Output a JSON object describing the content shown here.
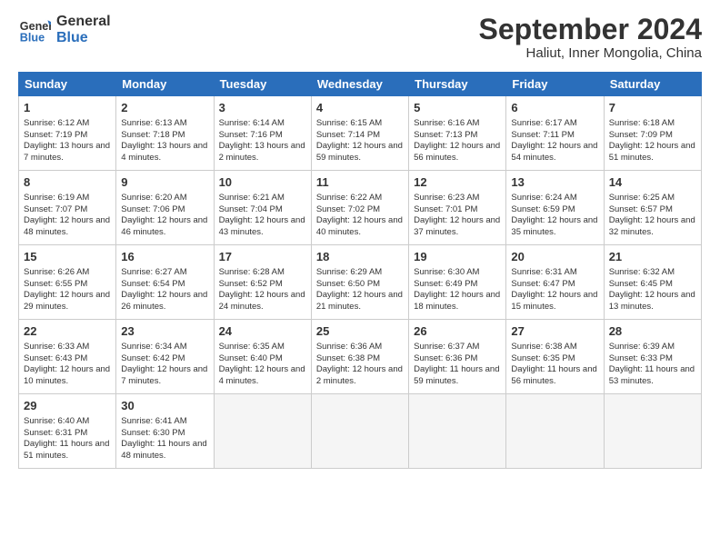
{
  "header": {
    "logo_line1": "General",
    "logo_line2": "Blue",
    "month": "September 2024",
    "location": "Haliut, Inner Mongolia, China"
  },
  "days": [
    "Sunday",
    "Monday",
    "Tuesday",
    "Wednesday",
    "Thursday",
    "Friday",
    "Saturday"
  ],
  "cells": [
    {
      "day": "",
      "empty": true
    },
    {
      "day": "",
      "empty": true
    },
    {
      "day": "",
      "empty": true
    },
    {
      "day": "",
      "empty": true
    },
    {
      "day": "",
      "empty": true
    },
    {
      "day": "",
      "empty": true
    },
    {
      "day": "7",
      "sunrise": "Sunrise: 6:18 AM",
      "sunset": "Sunset: 7:09 PM",
      "daylight": "Daylight: 12 hours and 51 minutes."
    },
    {
      "day": "8",
      "sunrise": "Sunrise: 6:19 AM",
      "sunset": "Sunset: 7:07 PM",
      "daylight": "Daylight: 12 hours and 48 minutes."
    },
    {
      "day": "9",
      "sunrise": "Sunrise: 6:20 AM",
      "sunset": "Sunset: 7:06 PM",
      "daylight": "Daylight: 12 hours and 46 minutes."
    },
    {
      "day": "10",
      "sunrise": "Sunrise: 6:21 AM",
      "sunset": "Sunset: 7:04 PM",
      "daylight": "Daylight: 12 hours and 43 minutes."
    },
    {
      "day": "11",
      "sunrise": "Sunrise: 6:22 AM",
      "sunset": "Sunset: 7:02 PM",
      "daylight": "Daylight: 12 hours and 40 minutes."
    },
    {
      "day": "12",
      "sunrise": "Sunrise: 6:23 AM",
      "sunset": "Sunset: 7:01 PM",
      "daylight": "Daylight: 12 hours and 37 minutes."
    },
    {
      "day": "13",
      "sunrise": "Sunrise: 6:24 AM",
      "sunset": "Sunset: 6:59 PM",
      "daylight": "Daylight: 12 hours and 35 minutes."
    },
    {
      "day": "14",
      "sunrise": "Sunrise: 6:25 AM",
      "sunset": "Sunset: 6:57 PM",
      "daylight": "Daylight: 12 hours and 32 minutes."
    },
    {
      "day": "15",
      "sunrise": "Sunrise: 6:26 AM",
      "sunset": "Sunset: 6:55 PM",
      "daylight": "Daylight: 12 hours and 29 minutes."
    },
    {
      "day": "16",
      "sunrise": "Sunrise: 6:27 AM",
      "sunset": "Sunset: 6:54 PM",
      "daylight": "Daylight: 12 hours and 26 minutes."
    },
    {
      "day": "17",
      "sunrise": "Sunrise: 6:28 AM",
      "sunset": "Sunset: 6:52 PM",
      "daylight": "Daylight: 12 hours and 24 minutes."
    },
    {
      "day": "18",
      "sunrise": "Sunrise: 6:29 AM",
      "sunset": "Sunset: 6:50 PM",
      "daylight": "Daylight: 12 hours and 21 minutes."
    },
    {
      "day": "19",
      "sunrise": "Sunrise: 6:30 AM",
      "sunset": "Sunset: 6:49 PM",
      "daylight": "Daylight: 12 hours and 18 minutes."
    },
    {
      "day": "20",
      "sunrise": "Sunrise: 6:31 AM",
      "sunset": "Sunset: 6:47 PM",
      "daylight": "Daylight: 12 hours and 15 minutes."
    },
    {
      "day": "21",
      "sunrise": "Sunrise: 6:32 AM",
      "sunset": "Sunset: 6:45 PM",
      "daylight": "Daylight: 12 hours and 13 minutes."
    },
    {
      "day": "22",
      "sunrise": "Sunrise: 6:33 AM",
      "sunset": "Sunset: 6:43 PM",
      "daylight": "Daylight: 12 hours and 10 minutes."
    },
    {
      "day": "23",
      "sunrise": "Sunrise: 6:34 AM",
      "sunset": "Sunset: 6:42 PM",
      "daylight": "Daylight: 12 hours and 7 minutes."
    },
    {
      "day": "24",
      "sunrise": "Sunrise: 6:35 AM",
      "sunset": "Sunset: 6:40 PM",
      "daylight": "Daylight: 12 hours and 4 minutes."
    },
    {
      "day": "25",
      "sunrise": "Sunrise: 6:36 AM",
      "sunset": "Sunset: 6:38 PM",
      "daylight": "Daylight: 12 hours and 2 minutes."
    },
    {
      "day": "26",
      "sunrise": "Sunrise: 6:37 AM",
      "sunset": "Sunset: 6:36 PM",
      "daylight": "Daylight: 11 hours and 59 minutes."
    },
    {
      "day": "27",
      "sunrise": "Sunrise: 6:38 AM",
      "sunset": "Sunset: 6:35 PM",
      "daylight": "Daylight: 11 hours and 56 minutes."
    },
    {
      "day": "28",
      "sunrise": "Sunrise: 6:39 AM",
      "sunset": "Sunset: 6:33 PM",
      "daylight": "Daylight: 11 hours and 53 minutes."
    },
    {
      "day": "29",
      "sunrise": "Sunrise: 6:40 AM",
      "sunset": "Sunset: 6:31 PM",
      "daylight": "Daylight: 11 hours and 51 minutes."
    },
    {
      "day": "30",
      "sunrise": "Sunrise: 6:41 AM",
      "sunset": "Sunset: 6:30 PM",
      "daylight": "Daylight: 11 hours and 48 minutes."
    },
    {
      "day": "",
      "empty": true
    },
    {
      "day": "",
      "empty": true
    },
    {
      "day": "",
      "empty": true
    },
    {
      "day": "",
      "empty": true
    },
    {
      "day": "",
      "empty": true
    }
  ],
  "week1": [
    {
      "day": "1",
      "sunrise": "Sunrise: 6:12 AM",
      "sunset": "Sunset: 7:19 PM",
      "daylight": "Daylight: 13 hours and 7 minutes."
    },
    {
      "day": "2",
      "sunrise": "Sunrise: 6:13 AM",
      "sunset": "Sunset: 7:18 PM",
      "daylight": "Daylight: 13 hours and 4 minutes."
    },
    {
      "day": "3",
      "sunrise": "Sunrise: 6:14 AM",
      "sunset": "Sunset: 7:16 PM",
      "daylight": "Daylight: 13 hours and 2 minutes."
    },
    {
      "day": "4",
      "sunrise": "Sunrise: 6:15 AM",
      "sunset": "Sunset: 7:14 PM",
      "daylight": "Daylight: 12 hours and 59 minutes."
    },
    {
      "day": "5",
      "sunrise": "Sunrise: 6:16 AM",
      "sunset": "Sunset: 7:13 PM",
      "daylight": "Daylight: 12 hours and 56 minutes."
    },
    {
      "day": "6",
      "sunrise": "Sunrise: 6:17 AM",
      "sunset": "Sunset: 7:11 PM",
      "daylight": "Daylight: 12 hours and 54 minutes."
    },
    {
      "day": "7",
      "sunrise": "Sunrise: 6:18 AM",
      "sunset": "Sunset: 7:09 PM",
      "daylight": "Daylight: 12 hours and 51 minutes."
    }
  ]
}
